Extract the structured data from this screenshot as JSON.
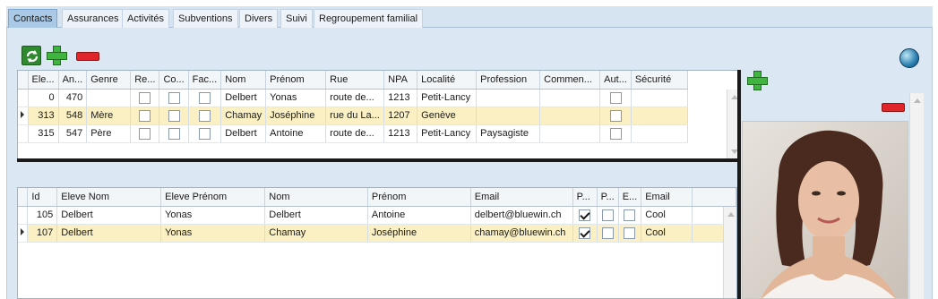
{
  "tabs": [
    {
      "label": "Contacts",
      "active": true
    },
    {
      "label": "Assurances",
      "active": false
    },
    {
      "label": "Activités",
      "active": false
    },
    {
      "label": "Subventions",
      "active": false
    },
    {
      "label": "Divers",
      "active": false
    },
    {
      "label": "Suivi",
      "active": false
    },
    {
      "label": "Regroupement familial",
      "active": false
    }
  ],
  "toolbar": {
    "refresh_icon": "refresh-icon",
    "add_icon": "plus-icon",
    "remove_icon": "minus-icon"
  },
  "contacts_grid": {
    "headers": [
      "Ele...",
      "An...",
      "Genre",
      "Re...",
      "Co...",
      "Fac...",
      "Nom",
      "Prénom",
      "Rue",
      "NPA",
      "Localité",
      "Profession",
      "Commen...",
      "Aut...",
      "Sécurité"
    ],
    "rows": [
      {
        "eleve": "0",
        "an": "470",
        "genre": "",
        "re": false,
        "co": false,
        "fac": false,
        "nom": "Delbert",
        "prenom": "Yonas",
        "rue": "route de...",
        "npa": "1213",
        "localite": "Petit-Lancy",
        "profession": "",
        "commentaire": "",
        "aut": false,
        "securite": "",
        "selected": false
      },
      {
        "eleve": "313",
        "an": "548",
        "genre": "Mère",
        "re": false,
        "co": false,
        "fac": false,
        "nom": "Chamay",
        "prenom": "Joséphine",
        "rue": "rue du La...",
        "npa": "1207",
        "localite": "Genève",
        "profession": "",
        "commentaire": "",
        "aut": false,
        "securite": "",
        "selected": true
      },
      {
        "eleve": "315",
        "an": "547",
        "genre": "Père",
        "re": false,
        "co": false,
        "fac": false,
        "nom": "Delbert",
        "prenom": "Antoine",
        "rue": "route de...",
        "npa": "1213",
        "localite": "Petit-Lancy",
        "profession": "Paysagiste",
        "commentaire": "",
        "aut": false,
        "securite": "",
        "selected": false
      }
    ]
  },
  "relations_grid": {
    "headers": [
      "Id",
      "Eleve Nom",
      "Eleve Prénom",
      "Nom",
      "Prénom",
      "Email",
      "P...",
      "P...",
      "E...",
      "Email"
    ],
    "rows": [
      {
        "id": "105",
        "eleve_nom": "Delbert",
        "eleve_prenom": "Yonas",
        "nom": "Delbert",
        "prenom": "Antoine",
        "email": "delbert@bluewin.ch",
        "p1": true,
        "p2": false,
        "e": false,
        "email_status": "Cool",
        "selected": false
      },
      {
        "id": "107",
        "eleve_nom": "Delbert",
        "eleve_prenom": "Yonas",
        "nom": "Chamay",
        "prenom": "Joséphine",
        "email": "chamay@bluewin.ch",
        "p1": true,
        "p2": false,
        "e": false,
        "email_status": "Cool",
        "selected": true
      }
    ]
  },
  "photo_panel": {
    "add_icon": "plus-icon",
    "remove_icon": "minus-icon",
    "refresh_icon": "globe-refresh-icon",
    "photo": "contact-photo"
  },
  "colors": {
    "tab_bar": "#d6e4f2",
    "active_tab": "#a9c9e6",
    "panel_bg": "#dbe7f3",
    "selected_row": "#fbf0c4",
    "add_green": "#3fb53f",
    "remove_red": "#e0262a"
  }
}
